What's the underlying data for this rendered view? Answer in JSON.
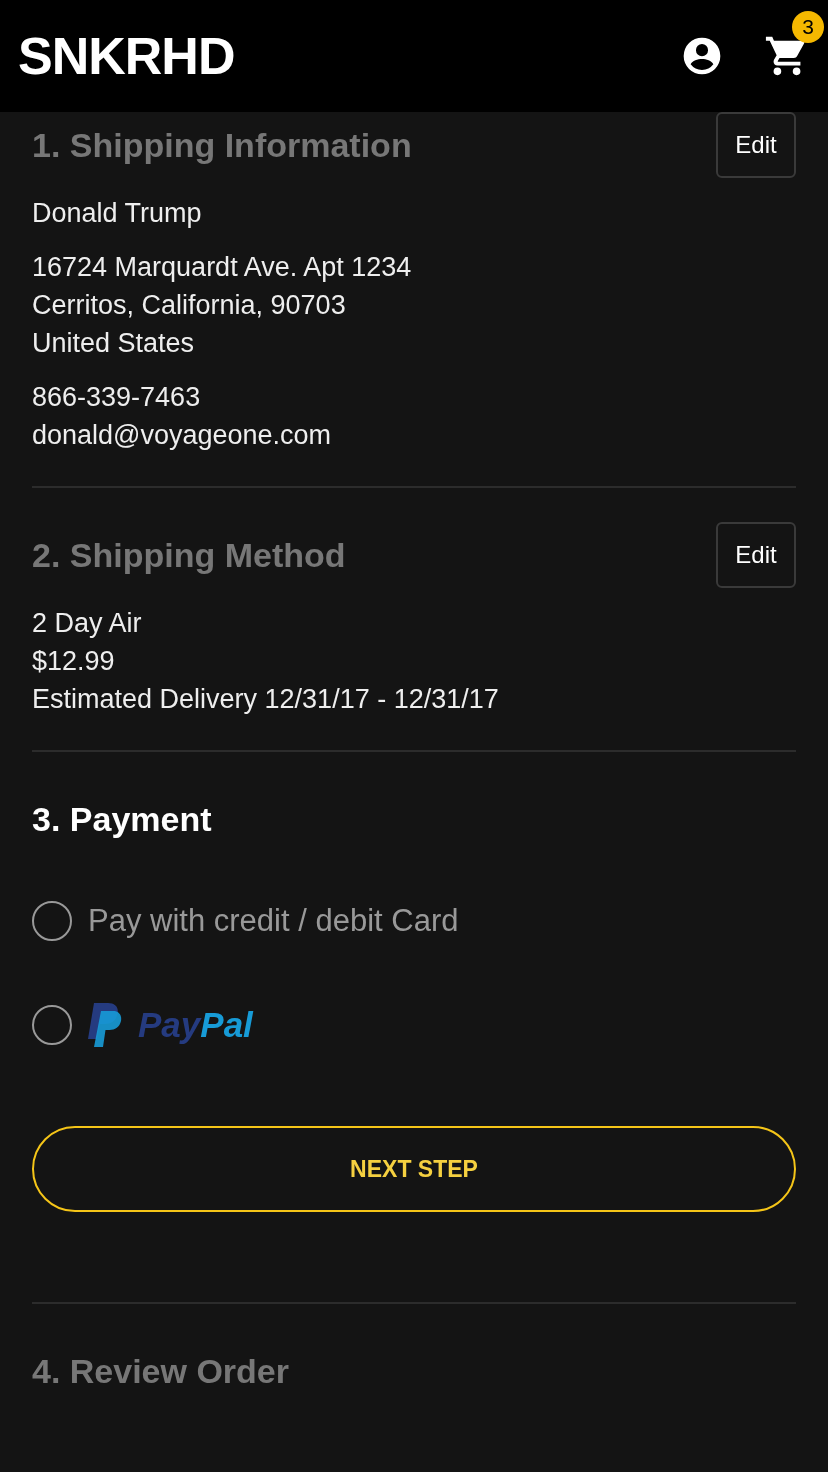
{
  "header": {
    "logo": "SNKRHD",
    "cart_count": "3"
  },
  "sections": [
    {
      "title": "1. Shipping Information",
      "active": false,
      "edit_button": "Edit",
      "blocks": [
        [
          "Donald Trump"
        ],
        [
          "16724 Marquardt Ave. Apt 1234",
          "Cerritos, California, 90703",
          "United States"
        ],
        [
          "866-339-7463",
          "donald@voyageone.com"
        ]
      ]
    },
    {
      "title": "2. Shipping Method",
      "active": false,
      "edit_button": "Edit",
      "blocks": [
        [
          "2 Day Air",
          "$12.99",
          "Estimated Delivery 12/31/17 - 12/31/17"
        ]
      ]
    },
    {
      "title": "3. Payment",
      "active": true,
      "payment_options": [
        {
          "kind": "text",
          "label": "Pay with credit / debit Card",
          "selected": false
        },
        {
          "kind": "paypal",
          "logo_parts": [
            "Pay",
            "Pal"
          ],
          "selected": false
        }
      ],
      "next_button": "NEXT STEP"
    },
    {
      "title": "4. Review Order",
      "active": false
    }
  ]
}
